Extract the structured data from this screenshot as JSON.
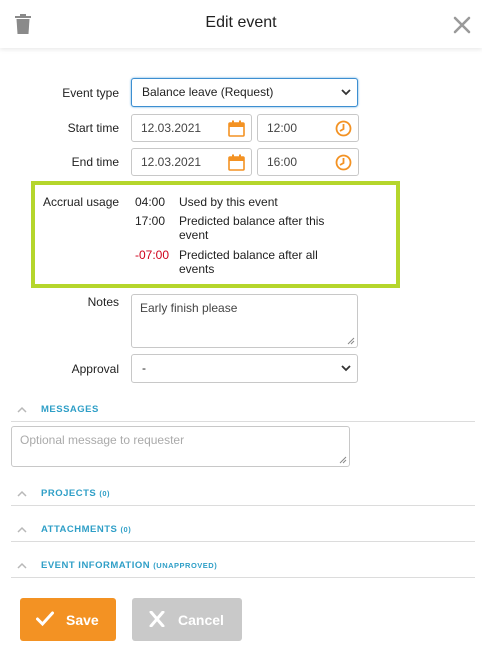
{
  "header": {
    "title": "Edit event"
  },
  "form": {
    "event_type": {
      "label": "Event type",
      "value": "Balance leave (Request)"
    },
    "start": {
      "label": "Start time",
      "date": "12.03.2021",
      "time": "12:00"
    },
    "end": {
      "label": "End time",
      "date": "12.03.2021",
      "time": "16:00"
    },
    "accrual": {
      "label": "Accrual usage",
      "rows": [
        {
          "value": "04:00",
          "desc": "Used by this event"
        },
        {
          "value": "17:00",
          "desc": "Predicted balance after this event"
        },
        {
          "value": "-07:00",
          "desc": "Predicted balance after all events"
        }
      ]
    },
    "notes": {
      "label": "Notes",
      "value": "Early finish please"
    },
    "approval": {
      "label": "Approval",
      "value": "-"
    }
  },
  "sections": {
    "messages": {
      "title": "MESSAGES",
      "placeholder": "Optional message to requester"
    },
    "projects": {
      "title": "PROJECTS",
      "sub": "(0)"
    },
    "attachments": {
      "title": "ATTACHMENTS",
      "sub": "(0)"
    },
    "event_info": {
      "title": "EVENT INFORMATION",
      "sub": "(UNAPPROVED)"
    }
  },
  "buttons": {
    "save": "Save",
    "cancel": "Cancel"
  },
  "colors": {
    "accent": "#f39223",
    "link": "#2f9fc7",
    "highlight": "#b5d62c",
    "negative": "#d0021b"
  }
}
